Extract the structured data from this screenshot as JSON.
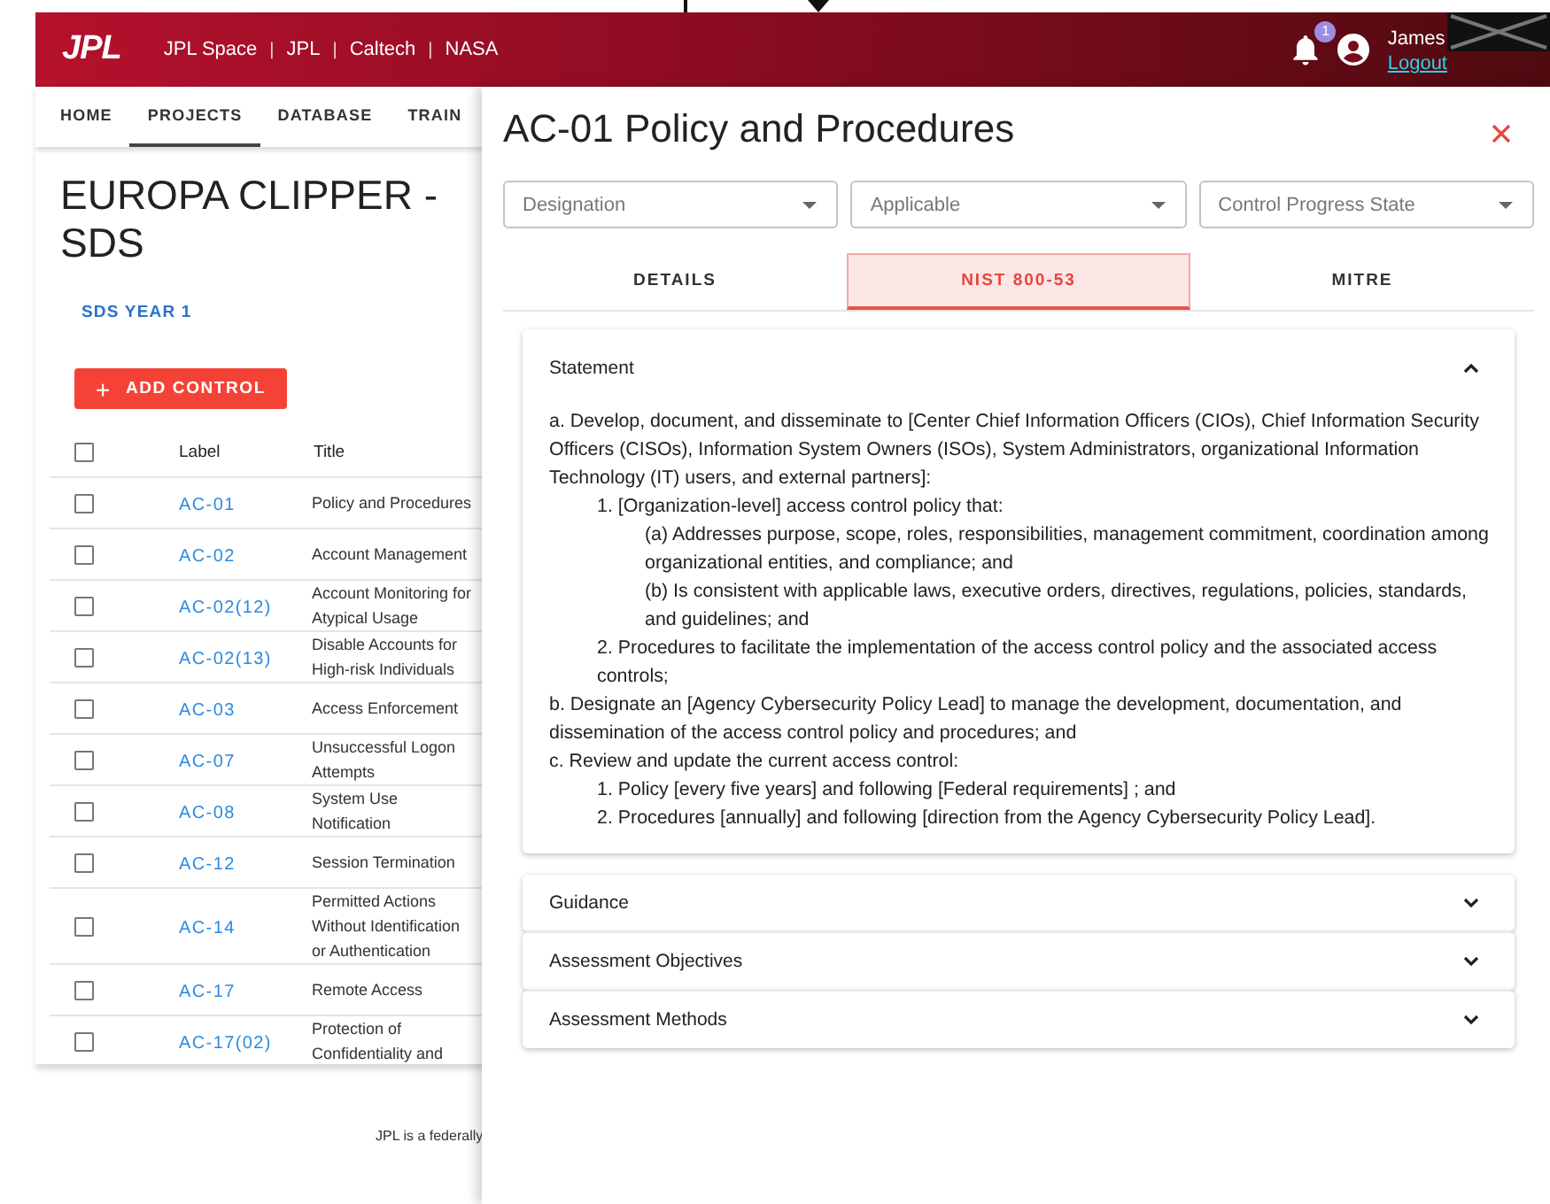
{
  "header": {
    "logo": "JPL",
    "links": [
      {
        "kind": "link",
        "text": "JPL Space"
      },
      {
        "kind": "separator",
        "text": "|"
      },
      {
        "kind": "link",
        "text": "JPL"
      },
      {
        "kind": "separator",
        "text": "|"
      },
      {
        "kind": "link",
        "text": "Caltech"
      },
      {
        "kind": "separator",
        "text": "|"
      },
      {
        "kind": "link",
        "text": "NASA"
      }
    ],
    "notification_count": "1",
    "user_name": "James",
    "logout": "Logout"
  },
  "nav_tabs": [
    {
      "label": "HOME",
      "selected": false
    },
    {
      "label": "PROJECTS",
      "selected": true
    },
    {
      "label": "DATABASE",
      "selected": false
    },
    {
      "label": "TRAIN",
      "selected": false
    }
  ],
  "project": {
    "title": "EUROPA CLIPPER - SDS",
    "subtab": "SDS YEAR 1",
    "add_button": {
      "icon": "+",
      "label": "ADD CONTROL"
    }
  },
  "table": {
    "header_checked": false,
    "columns": [
      "Label",
      "Title"
    ],
    "rows": [
      {
        "label": "AC-01",
        "title": "Policy and Procedures",
        "checked": false
      },
      {
        "label": "AC-02",
        "title": "Account Management",
        "checked": false
      },
      {
        "label": "AC-02(12)",
        "title": "Account Monitoring for Atypical Usage",
        "checked": false
      },
      {
        "label": "AC-02(13)",
        "title": "Disable Accounts for High-risk Individuals",
        "checked": false
      },
      {
        "label": "AC-03",
        "title": "Access Enforcement",
        "checked": false
      },
      {
        "label": "AC-07",
        "title": "Unsuccessful Logon Attempts",
        "checked": false
      },
      {
        "label": "AC-08",
        "title": "System Use Notification",
        "checked": false
      },
      {
        "label": "AC-12",
        "title": "Session Termination",
        "checked": false
      },
      {
        "label": "AC-14",
        "title": "Permitted Actions Without Identification or Authentication",
        "checked": false
      },
      {
        "label": "AC-17",
        "title": "Remote Access",
        "checked": false
      },
      {
        "label": "AC-17(02)",
        "title": "Protection of Confidentiality and",
        "checked": false
      }
    ]
  },
  "footer": "JPL is a federally",
  "drawer": {
    "title": "AC-01 Policy and Procedures",
    "selects": [
      {
        "placeholder": "Designation"
      },
      {
        "placeholder": "Applicable"
      },
      {
        "placeholder": "Control Progress State"
      }
    ],
    "tabs": [
      {
        "label": "DETAILS",
        "selected": false
      },
      {
        "label": "NIST 800-53",
        "selected": true
      },
      {
        "label": "MITRE",
        "selected": false
      }
    ],
    "sections": [
      {
        "title": "Statement",
        "expanded": true,
        "content": [
          {
            "text": "a. Develop, document, and disseminate to [Center Chief Information Officers (CIOs), Chief Information Security Officers (CISOs), Information System Owners (ISOs), System Administrators, organizational Information Technology (IT) users, and external partners]:",
            "children": [
              {
                "text": "1. [Organization-level] access control policy that:",
                "children": [
                  {
                    "text": "(a) Addresses purpose, scope, roles, responsibilities, management commitment, coordination among organizational entities, and compliance; and"
                  },
                  {
                    "text": "(b) Is consistent with applicable laws, executive orders, directives, regulations, policies, standards, and guidelines; and"
                  }
                ]
              },
              {
                "text": "2. Procedures to facilitate the implementation of the access control policy and the associated access controls;"
              }
            ]
          },
          {
            "text": "b. Designate an [Agency Cybersecurity Policy Lead] to manage the development, documentation, and dissemination of the access control policy and procedures; and"
          },
          {
            "text": "c. Review and update the current access control:",
            "children": [
              {
                "text": "1. Policy [every five years] and following [Federal requirements] ; and"
              },
              {
                "text": "2. Procedures [annually] and following [direction from the Agency Cybersecurity Policy Lead]."
              }
            ]
          }
        ]
      },
      {
        "title": "Guidance",
        "expanded": false
      },
      {
        "title": "Assessment Objectives",
        "expanded": false
      },
      {
        "title": "Assessment Methods",
        "expanded": false
      }
    ]
  }
}
